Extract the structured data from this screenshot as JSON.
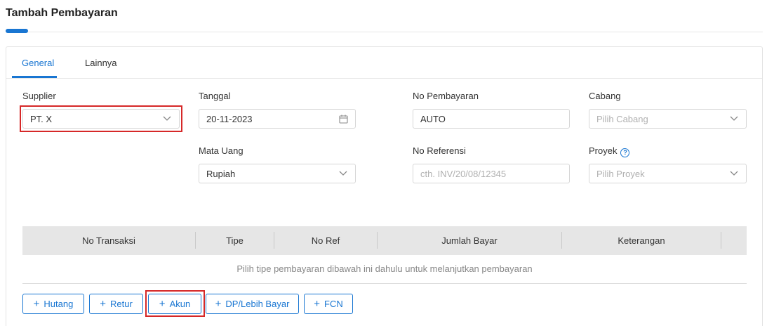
{
  "page": {
    "title": "Tambah Pembayaran"
  },
  "tabs": [
    {
      "label": "General",
      "active": true
    },
    {
      "label": "Lainnya",
      "active": false
    }
  ],
  "form": {
    "supplier": {
      "label": "Supplier",
      "value": "PT. X"
    },
    "tanggal": {
      "label": "Tanggal",
      "value": "20-11-2023"
    },
    "no_pembayaran": {
      "label": "No Pembayaran",
      "value": "AUTO"
    },
    "cabang": {
      "label": "Cabang",
      "placeholder": "Pilih Cabang"
    },
    "mata_uang": {
      "label": "Mata Uang",
      "value": "Rupiah"
    },
    "no_referensi": {
      "label": "No Referensi",
      "placeholder": "cth. INV/20/08/12345"
    },
    "proyek": {
      "label": "Proyek",
      "placeholder": "Pilih Proyek",
      "help": "?"
    }
  },
  "table": {
    "columns": [
      "No Transaksi",
      "Tipe",
      "No Ref",
      "Jumlah Bayar",
      "Keterangan"
    ],
    "empty_message": "Pilih tipe pembayaran dibawah ini dahulu untuk melanjutkan pembayaran"
  },
  "buttons": [
    {
      "label": "Hutang"
    },
    {
      "label": "Retur"
    },
    {
      "label": "Akun"
    },
    {
      "label": "DP/Lebih Bayar"
    },
    {
      "label": "FCN"
    }
  ],
  "icons": {
    "plus": "+",
    "dropdown": "chevron-down-icon",
    "calendar": "calendar-icon",
    "help": "help-circle-icon"
  },
  "colors": {
    "accent": "#1976d2",
    "highlight": "#d62828",
    "table_header": "#e6e6e6"
  }
}
